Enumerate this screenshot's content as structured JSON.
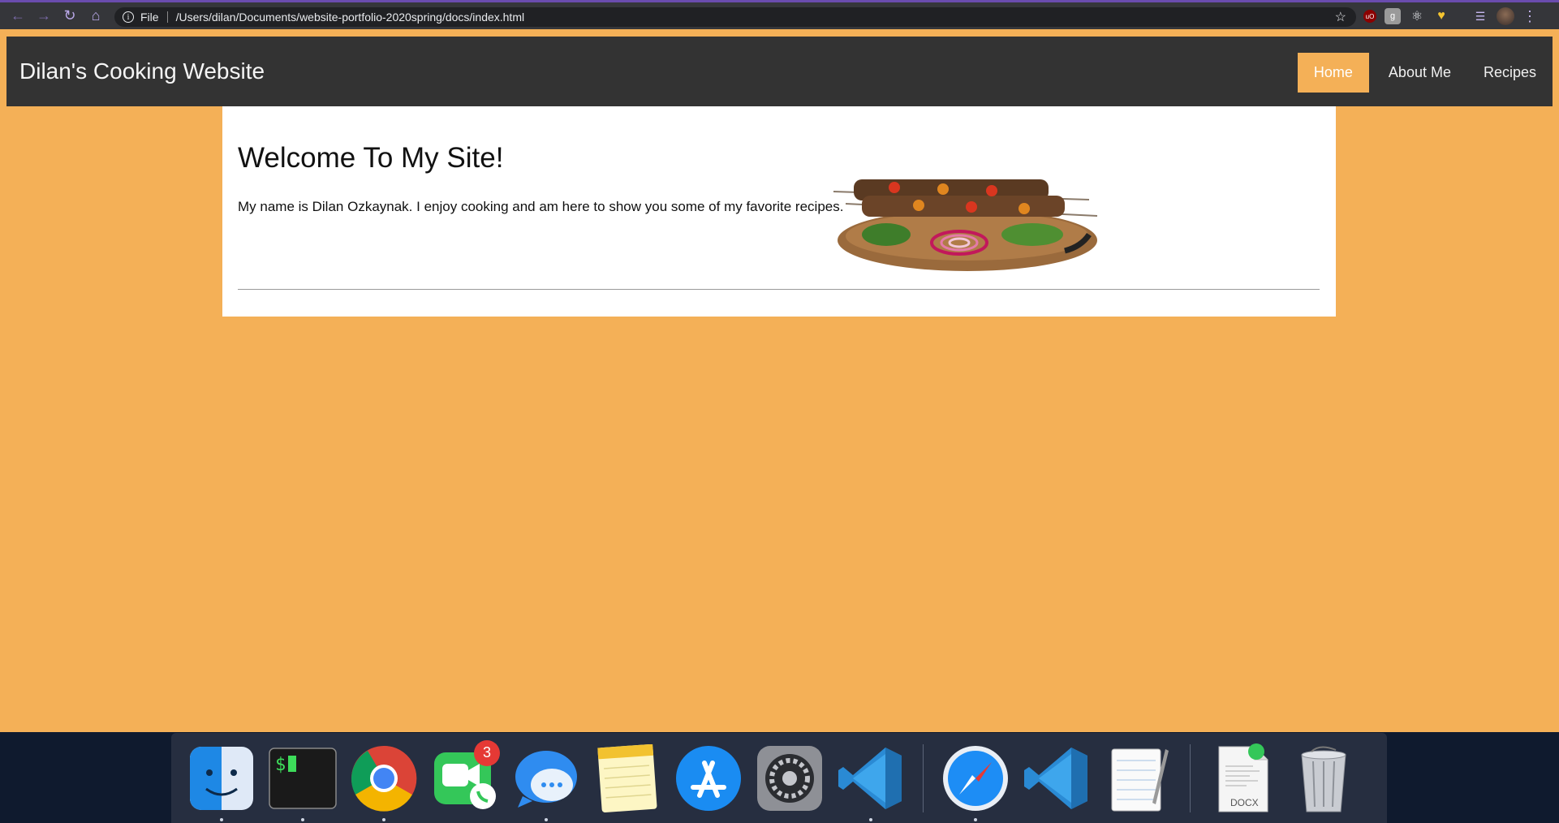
{
  "browser": {
    "url": "/Users/dilan/Documents/website-portfolio-2020spring/docs/index.html",
    "scheme_label": "File"
  },
  "site": {
    "brand": "Dilan's Cooking Website",
    "nav": [
      {
        "label": "Home",
        "active": true
      },
      {
        "label": "About Me",
        "active": false
      },
      {
        "label": "Recipes",
        "active": false
      }
    ],
    "welcome_heading": "Welcome To My Site!",
    "intro_text": "My name is Dilan Ozkaynak. I enjoy cooking and am here to show you some of my favorite recipes."
  },
  "dock": {
    "facetime_badge": "3",
    "docx_label": "DOCX",
    "items": [
      "finder-icon",
      "terminal-icon",
      "chrome-icon",
      "facetime-icon",
      "messages-icon",
      "notes-icon",
      "app-store-icon",
      "system-preferences-icon",
      "vscode-icon",
      "safari-icon",
      "vscode-insiders-icon",
      "textedit-icon",
      "docx-file-icon",
      "trash-icon"
    ]
  },
  "colors": {
    "page_bg": "#f4b057",
    "nav_bg": "#333333",
    "accent": "#f4b057"
  }
}
